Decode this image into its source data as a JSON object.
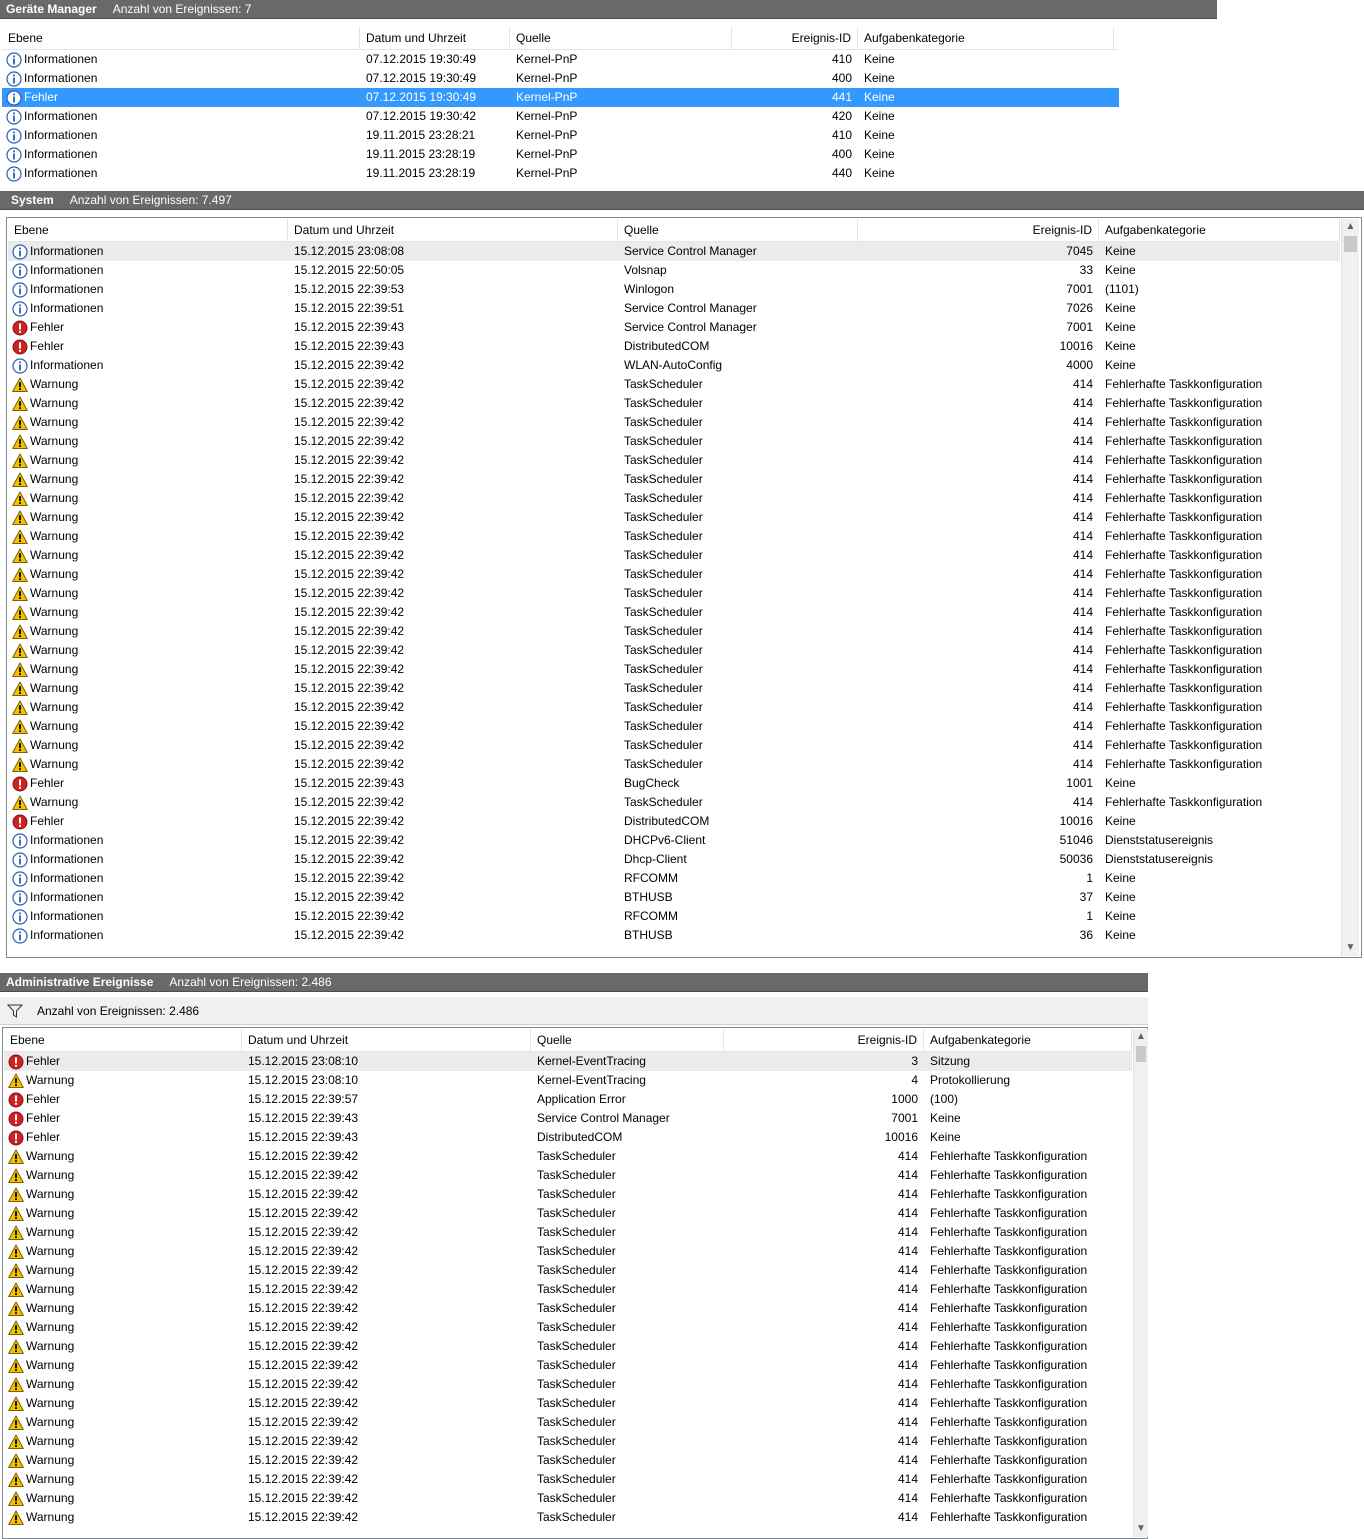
{
  "colors": {
    "titlebar": "#696969",
    "selection": "#3399ff",
    "info": "#2b5fb3",
    "error": "#cc2222",
    "warning": "#f2c200"
  },
  "level_icons": {
    "Informationen": "info-icon",
    "Fehler": "error-icon",
    "Warnung": "warning-icon"
  },
  "panels": [
    {
      "id": "geraete",
      "title": "Geräte Manager",
      "count_label": "Anzahl von Ereignissen: 7",
      "columns": [
        "Ebene",
        "Datum und Uhrzeit",
        "Quelle",
        "Ereignis-ID",
        "Aufgabenkategorie"
      ],
      "rows": [
        {
          "level": "Informationen",
          "date": "07.12.2015 19:30:49",
          "source": "Kernel-PnP",
          "id": "410",
          "category": "Keine"
        },
        {
          "level": "Informationen",
          "date": "07.12.2015 19:30:49",
          "source": "Kernel-PnP",
          "id": "400",
          "category": "Keine"
        },
        {
          "level": "Fehler",
          "date": "07.12.2015 19:30:49",
          "source": "Kernel-PnP",
          "id": "441",
          "category": "Keine",
          "selected": true,
          "icon": "info-icon"
        },
        {
          "level": "Informationen",
          "date": "07.12.2015 19:30:42",
          "source": "Kernel-PnP",
          "id": "420",
          "category": "Keine"
        },
        {
          "level": "Informationen",
          "date": "19.11.2015 23:28:21",
          "source": "Kernel-PnP",
          "id": "410",
          "category": "Keine"
        },
        {
          "level": "Informationen",
          "date": "19.11.2015 23:28:19",
          "source": "Kernel-PnP",
          "id": "400",
          "category": "Keine"
        },
        {
          "level": "Informationen",
          "date": "19.11.2015 23:28:19",
          "source": "Kernel-PnP",
          "id": "440",
          "category": "Keine"
        }
      ]
    },
    {
      "id": "system",
      "title": "System",
      "count_label": "Anzahl von Ereignissen: 7.497",
      "columns": [
        "Ebene",
        "Datum und Uhrzeit",
        "Quelle",
        "Ereignis-ID",
        "Aufgabenkategorie"
      ],
      "rows": [
        {
          "level": "Informationen",
          "date": "15.12.2015 23:08:08",
          "source": "Service Control Manager",
          "id": "7045",
          "category": "Keine",
          "highlight": true
        },
        {
          "level": "Informationen",
          "date": "15.12.2015 22:50:05",
          "source": "Volsnap",
          "id": "33",
          "category": "Keine"
        },
        {
          "level": "Informationen",
          "date": "15.12.2015 22:39:53",
          "source": "Winlogon",
          "id": "7001",
          "category": "(1101)"
        },
        {
          "level": "Informationen",
          "date": "15.12.2015 22:39:51",
          "source": "Service Control Manager",
          "id": "7026",
          "category": "Keine"
        },
        {
          "level": "Fehler",
          "date": "15.12.2015 22:39:43",
          "source": "Service Control Manager",
          "id": "7001",
          "category": "Keine"
        },
        {
          "level": "Fehler",
          "date": "15.12.2015 22:39:43",
          "source": "DistributedCOM",
          "id": "10016",
          "category": "Keine"
        },
        {
          "level": "Informationen",
          "date": "15.12.2015 22:39:42",
          "source": "WLAN-AutoConfig",
          "id": "4000",
          "category": "Keine"
        },
        {
          "level": "Warnung",
          "date": "15.12.2015 22:39:42",
          "source": "TaskScheduler",
          "id": "414",
          "category": "Fehlerhafte Taskkonfiguration"
        },
        {
          "level": "Warnung",
          "date": "15.12.2015 22:39:42",
          "source": "TaskScheduler",
          "id": "414",
          "category": "Fehlerhafte Taskkonfiguration"
        },
        {
          "level": "Warnung",
          "date": "15.12.2015 22:39:42",
          "source": "TaskScheduler",
          "id": "414",
          "category": "Fehlerhafte Taskkonfiguration"
        },
        {
          "level": "Warnung",
          "date": "15.12.2015 22:39:42",
          "source": "TaskScheduler",
          "id": "414",
          "category": "Fehlerhafte Taskkonfiguration"
        },
        {
          "level": "Warnung",
          "date": "15.12.2015 22:39:42",
          "source": "TaskScheduler",
          "id": "414",
          "category": "Fehlerhafte Taskkonfiguration"
        },
        {
          "level": "Warnung",
          "date": "15.12.2015 22:39:42",
          "source": "TaskScheduler",
          "id": "414",
          "category": "Fehlerhafte Taskkonfiguration"
        },
        {
          "level": "Warnung",
          "date": "15.12.2015 22:39:42",
          "source": "TaskScheduler",
          "id": "414",
          "category": "Fehlerhafte Taskkonfiguration"
        },
        {
          "level": "Warnung",
          "date": "15.12.2015 22:39:42",
          "source": "TaskScheduler",
          "id": "414",
          "category": "Fehlerhafte Taskkonfiguration"
        },
        {
          "level": "Warnung",
          "date": "15.12.2015 22:39:42",
          "source": "TaskScheduler",
          "id": "414",
          "category": "Fehlerhafte Taskkonfiguration"
        },
        {
          "level": "Warnung",
          "date": "15.12.2015 22:39:42",
          "source": "TaskScheduler",
          "id": "414",
          "category": "Fehlerhafte Taskkonfiguration"
        },
        {
          "level": "Warnung",
          "date": "15.12.2015 22:39:42",
          "source": "TaskScheduler",
          "id": "414",
          "category": "Fehlerhafte Taskkonfiguration"
        },
        {
          "level": "Warnung",
          "date": "15.12.2015 22:39:42",
          "source": "TaskScheduler",
          "id": "414",
          "category": "Fehlerhafte Taskkonfiguration"
        },
        {
          "level": "Warnung",
          "date": "15.12.2015 22:39:42",
          "source": "TaskScheduler",
          "id": "414",
          "category": "Fehlerhafte Taskkonfiguration"
        },
        {
          "level": "Warnung",
          "date": "15.12.2015 22:39:42",
          "source": "TaskScheduler",
          "id": "414",
          "category": "Fehlerhafte Taskkonfiguration"
        },
        {
          "level": "Warnung",
          "date": "15.12.2015 22:39:42",
          "source": "TaskScheduler",
          "id": "414",
          "category": "Fehlerhafte Taskkonfiguration"
        },
        {
          "level": "Warnung",
          "date": "15.12.2015 22:39:42",
          "source": "TaskScheduler",
          "id": "414",
          "category": "Fehlerhafte Taskkonfiguration"
        },
        {
          "level": "Warnung",
          "date": "15.12.2015 22:39:42",
          "source": "TaskScheduler",
          "id": "414",
          "category": "Fehlerhafte Taskkonfiguration"
        },
        {
          "level": "Warnung",
          "date": "15.12.2015 22:39:42",
          "source": "TaskScheduler",
          "id": "414",
          "category": "Fehlerhafte Taskkonfiguration"
        },
        {
          "level": "Warnung",
          "date": "15.12.2015 22:39:42",
          "source": "TaskScheduler",
          "id": "414",
          "category": "Fehlerhafte Taskkonfiguration"
        },
        {
          "level": "Warnung",
          "date": "15.12.2015 22:39:42",
          "source": "TaskScheduler",
          "id": "414",
          "category": "Fehlerhafte Taskkonfiguration"
        },
        {
          "level": "Warnung",
          "date": "15.12.2015 22:39:42",
          "source": "TaskScheduler",
          "id": "414",
          "category": "Fehlerhafte Taskkonfiguration"
        },
        {
          "level": "Fehler",
          "date": "15.12.2015 22:39:43",
          "source": "BugCheck",
          "id": "1001",
          "category": "Keine"
        },
        {
          "level": "Warnung",
          "date": "15.12.2015 22:39:42",
          "source": "TaskScheduler",
          "id": "414",
          "category": "Fehlerhafte Taskkonfiguration"
        },
        {
          "level": "Fehler",
          "date": "15.12.2015 22:39:42",
          "source": "DistributedCOM",
          "id": "10016",
          "category": "Keine"
        },
        {
          "level": "Informationen",
          "date": "15.12.2015 22:39:42",
          "source": "DHCPv6-Client",
          "id": "51046",
          "category": "Dienststatusereignis"
        },
        {
          "level": "Informationen",
          "date": "15.12.2015 22:39:42",
          "source": "Dhcp-Client",
          "id": "50036",
          "category": "Dienststatusereignis"
        },
        {
          "level": "Informationen",
          "date": "15.12.2015 22:39:42",
          "source": "RFCOMM",
          "id": "1",
          "category": "Keine"
        },
        {
          "level": "Informationen",
          "date": "15.12.2015 22:39:42",
          "source": "BTHUSB",
          "id": "37",
          "category": "Keine"
        },
        {
          "level": "Informationen",
          "date": "15.12.2015 22:39:42",
          "source": "RFCOMM",
          "id": "1",
          "category": "Keine"
        },
        {
          "level": "Informationen",
          "date": "15.12.2015 22:39:42",
          "source": "BTHUSB",
          "id": "36",
          "category": "Keine"
        }
      ]
    },
    {
      "id": "admin",
      "title": "Administrative Ereignisse",
      "count_label": "Anzahl von Ereignissen: 2.486",
      "filter_label": "Anzahl von Ereignissen: 2.486",
      "columns": [
        "Ebene",
        "Datum und Uhrzeit",
        "Quelle",
        "Ereignis-ID",
        "Aufgabenkategorie"
      ],
      "rows": [
        {
          "level": "Fehler",
          "date": "15.12.2015 23:08:10",
          "source": "Kernel-EventTracing",
          "id": "3",
          "category": "Sitzung",
          "highlight": true
        },
        {
          "level": "Warnung",
          "date": "15.12.2015 23:08:10",
          "source": "Kernel-EventTracing",
          "id": "4",
          "category": "Protokollierung"
        },
        {
          "level": "Fehler",
          "date": "15.12.2015 22:39:57",
          "source": "Application Error",
          "id": "1000",
          "category": "(100)"
        },
        {
          "level": "Fehler",
          "date": "15.12.2015 22:39:43",
          "source": "Service Control Manager",
          "id": "7001",
          "category": "Keine"
        },
        {
          "level": "Fehler",
          "date": "15.12.2015 22:39:43",
          "source": "DistributedCOM",
          "id": "10016",
          "category": "Keine"
        },
        {
          "level": "Warnung",
          "date": "15.12.2015 22:39:42",
          "source": "TaskScheduler",
          "id": "414",
          "category": "Fehlerhafte Taskkonfiguration"
        },
        {
          "level": "Warnung",
          "date": "15.12.2015 22:39:42",
          "source": "TaskScheduler",
          "id": "414",
          "category": "Fehlerhafte Taskkonfiguration"
        },
        {
          "level": "Warnung",
          "date": "15.12.2015 22:39:42",
          "source": "TaskScheduler",
          "id": "414",
          "category": "Fehlerhafte Taskkonfiguration"
        },
        {
          "level": "Warnung",
          "date": "15.12.2015 22:39:42",
          "source": "TaskScheduler",
          "id": "414",
          "category": "Fehlerhafte Taskkonfiguration"
        },
        {
          "level": "Warnung",
          "date": "15.12.2015 22:39:42",
          "source": "TaskScheduler",
          "id": "414",
          "category": "Fehlerhafte Taskkonfiguration"
        },
        {
          "level": "Warnung",
          "date": "15.12.2015 22:39:42",
          "source": "TaskScheduler",
          "id": "414",
          "category": "Fehlerhafte Taskkonfiguration"
        },
        {
          "level": "Warnung",
          "date": "15.12.2015 22:39:42",
          "source": "TaskScheduler",
          "id": "414",
          "category": "Fehlerhafte Taskkonfiguration"
        },
        {
          "level": "Warnung",
          "date": "15.12.2015 22:39:42",
          "source": "TaskScheduler",
          "id": "414",
          "category": "Fehlerhafte Taskkonfiguration"
        },
        {
          "level": "Warnung",
          "date": "15.12.2015 22:39:42",
          "source": "TaskScheduler",
          "id": "414",
          "category": "Fehlerhafte Taskkonfiguration"
        },
        {
          "level": "Warnung",
          "date": "15.12.2015 22:39:42",
          "source": "TaskScheduler",
          "id": "414",
          "category": "Fehlerhafte Taskkonfiguration"
        },
        {
          "level": "Warnung",
          "date": "15.12.2015 22:39:42",
          "source": "TaskScheduler",
          "id": "414",
          "category": "Fehlerhafte Taskkonfiguration"
        },
        {
          "level": "Warnung",
          "date": "15.12.2015 22:39:42",
          "source": "TaskScheduler",
          "id": "414",
          "category": "Fehlerhafte Taskkonfiguration"
        },
        {
          "level": "Warnung",
          "date": "15.12.2015 22:39:42",
          "source": "TaskScheduler",
          "id": "414",
          "category": "Fehlerhafte Taskkonfiguration"
        },
        {
          "level": "Warnung",
          "date": "15.12.2015 22:39:42",
          "source": "TaskScheduler",
          "id": "414",
          "category": "Fehlerhafte Taskkonfiguration"
        },
        {
          "level": "Warnung",
          "date": "15.12.2015 22:39:42",
          "source": "TaskScheduler",
          "id": "414",
          "category": "Fehlerhafte Taskkonfiguration"
        },
        {
          "level": "Warnung",
          "date": "15.12.2015 22:39:42",
          "source": "TaskScheduler",
          "id": "414",
          "category": "Fehlerhafte Taskkonfiguration"
        },
        {
          "level": "Warnung",
          "date": "15.12.2015 22:39:42",
          "source": "TaskScheduler",
          "id": "414",
          "category": "Fehlerhafte Taskkonfiguration"
        },
        {
          "level": "Warnung",
          "date": "15.12.2015 22:39:42",
          "source": "TaskScheduler",
          "id": "414",
          "category": "Fehlerhafte Taskkonfiguration"
        },
        {
          "level": "Warnung",
          "date": "15.12.2015 22:39:42",
          "source": "TaskScheduler",
          "id": "414",
          "category": "Fehlerhafte Taskkonfiguration"
        },
        {
          "level": "Warnung",
          "date": "15.12.2015 22:39:42",
          "source": "TaskScheduler",
          "id": "414",
          "category": "Fehlerhafte Taskkonfiguration"
        }
      ]
    }
  ]
}
